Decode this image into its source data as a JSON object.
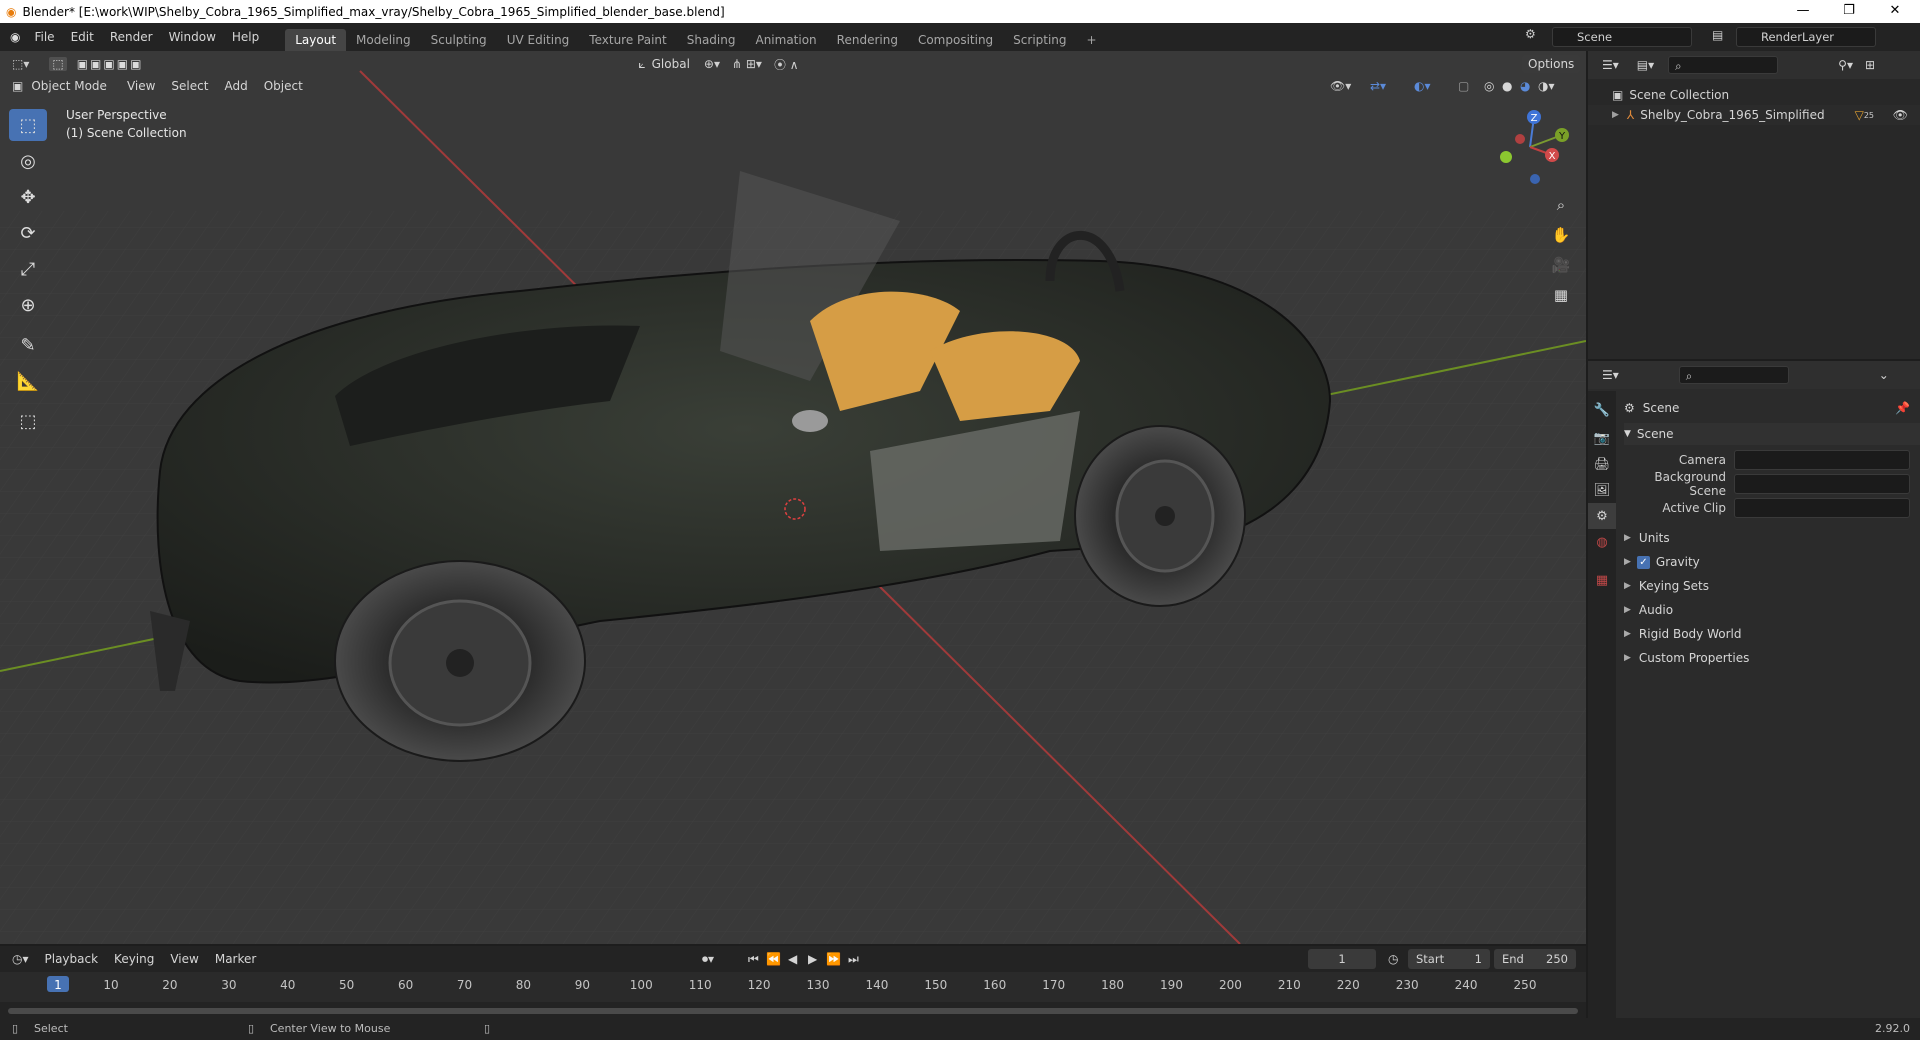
{
  "window": {
    "title": "Blender* [E:\\work\\WIP\\Shelby_Cobra_1965_Simplified_max_vray/Shelby_Cobra_1965_Simplified_blender_base.blend]",
    "minimize": "—",
    "restore": "❐",
    "close": "✕"
  },
  "menu": [
    "File",
    "Edit",
    "Render",
    "Window",
    "Help"
  ],
  "workspaces": [
    "Layout",
    "Modeling",
    "Sculpting",
    "UV Editing",
    "Texture Paint",
    "Shading",
    "Animation",
    "Rendering",
    "Compositing",
    "Scripting",
    "+"
  ],
  "scene_field": "Scene",
  "renderlayer_field": "RenderLayer",
  "viewport": {
    "mode": "Object Mode",
    "menus": [
      "View",
      "Select",
      "Add",
      "Object"
    ],
    "orientation": "Global",
    "options": "Options",
    "info_line1": "User Perspective",
    "info_line2": "(1) Scene Collection",
    "gizmo": {
      "z": "Z",
      "y": "Y",
      "x": "X"
    }
  },
  "outliner": {
    "root": "Scene Collection",
    "items": [
      "Shelby_Cobra_1965_Simplified"
    ],
    "item_badge": "25"
  },
  "properties": {
    "context": "Scene",
    "panel": "Scene",
    "fields": [
      {
        "label": "Camera",
        "value": ""
      },
      {
        "label": "Background Scene",
        "value": ""
      },
      {
        "label": "Active Clip",
        "value": ""
      }
    ],
    "subpanels": [
      "Units",
      "Gravity",
      "Keying Sets",
      "Audio",
      "Rigid Body World",
      "Custom Properties"
    ],
    "gravity_checked": true
  },
  "timeline": {
    "menus": [
      "Playback",
      "Keying",
      "View",
      "Marker"
    ],
    "current_frame": "1",
    "start_label": "Start",
    "start": "1",
    "end_label": "End",
    "end": "250",
    "ticks": [
      "1",
      "10",
      "20",
      "30",
      "40",
      "50",
      "60",
      "70",
      "80",
      "90",
      "100",
      "110",
      "120",
      "130",
      "140",
      "150",
      "160",
      "170",
      "180",
      "190",
      "200",
      "210",
      "220",
      "230",
      "240",
      "250"
    ]
  },
  "status": {
    "left": "Select",
    "middle": "Center View to Mouse",
    "version": "2.92.0"
  },
  "colors": {
    "accent": "#4772b3",
    "x_axis": "#a03a3a",
    "y_axis": "#6b8e23",
    "seat": "#d69d45",
    "body": "#272b25"
  }
}
